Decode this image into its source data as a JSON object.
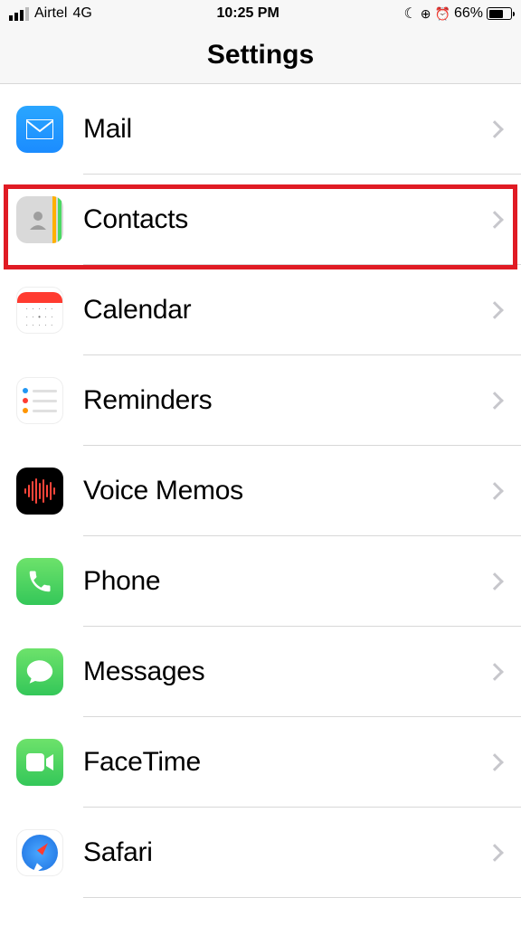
{
  "status": {
    "carrier": "Airtel",
    "network": "4G",
    "time": "10:25 PM",
    "battery_pct": "66%",
    "battery_fill": 66
  },
  "nav": {
    "title": "Settings"
  },
  "rows": [
    {
      "id": "mail",
      "label": "Mail",
      "icon": "mail-icon"
    },
    {
      "id": "contacts",
      "label": "Contacts",
      "icon": "contacts-icon",
      "highlighted": true
    },
    {
      "id": "calendar",
      "label": "Calendar",
      "icon": "calendar-icon"
    },
    {
      "id": "reminders",
      "label": "Reminders",
      "icon": "reminders-icon"
    },
    {
      "id": "voicememos",
      "label": "Voice Memos",
      "icon": "voice-memos-icon"
    },
    {
      "id": "phone",
      "label": "Phone",
      "icon": "phone-icon"
    },
    {
      "id": "messages",
      "label": "Messages",
      "icon": "messages-icon"
    },
    {
      "id": "facetime",
      "label": "FaceTime",
      "icon": "facetime-icon"
    },
    {
      "id": "safari",
      "label": "Safari",
      "icon": "safari-icon"
    }
  ],
  "highlight_row_index": 1
}
